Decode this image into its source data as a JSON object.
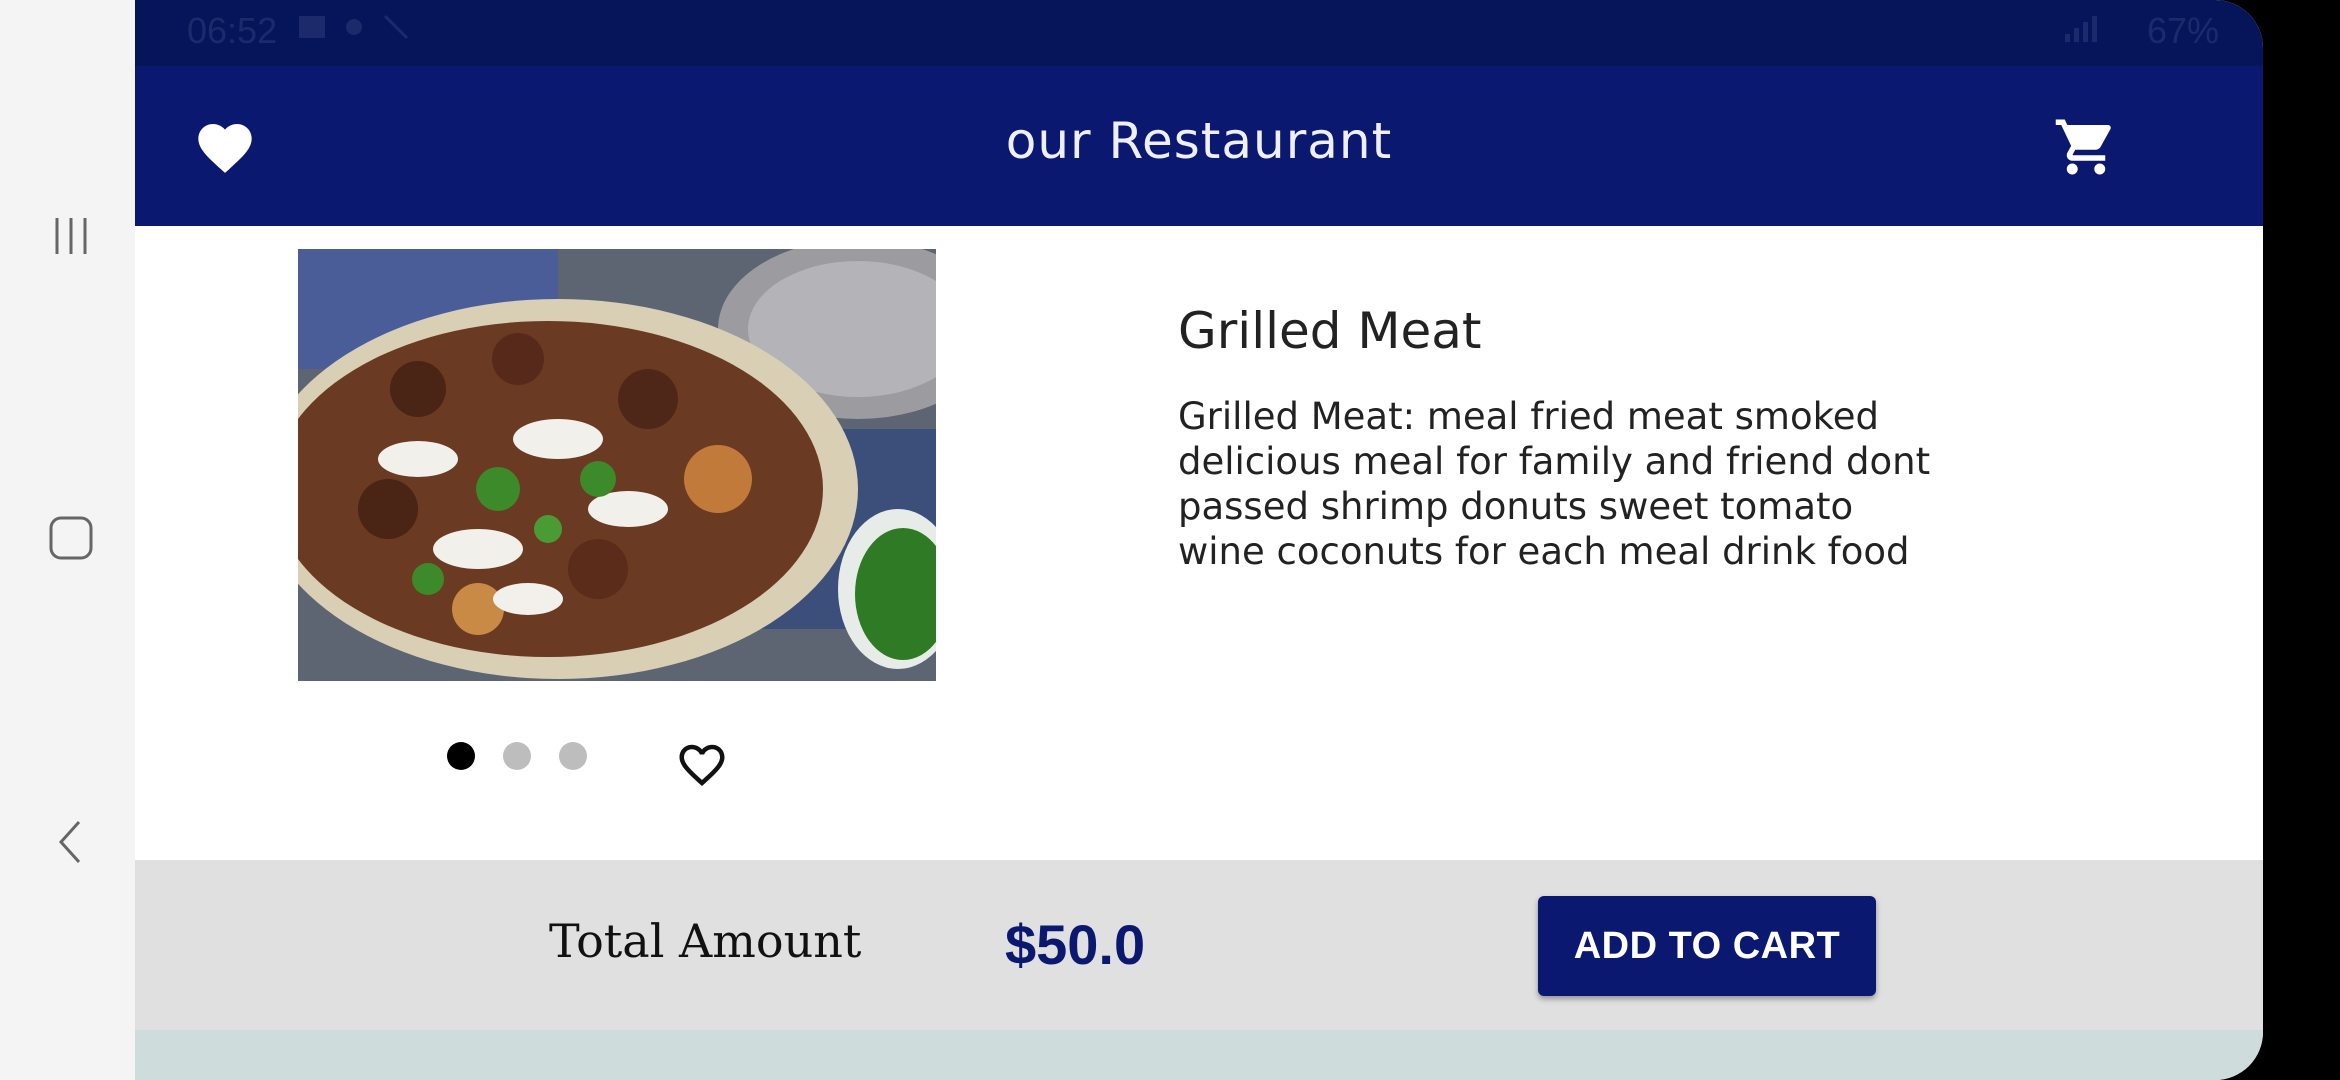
{
  "status_bar": {
    "time": "06:52",
    "battery": "67%",
    "icons": [
      "image-icon",
      "brightness-icon",
      "magic-wand-icon",
      "signal-icon",
      "battery-icon"
    ]
  },
  "app_bar": {
    "title": "our Restaurant",
    "favorites_icon": "heart-filled-icon",
    "cart_icon": "cart-icon"
  },
  "product": {
    "name": "Grilled Meat",
    "description": "Grilled Meat: meal fried meat smoked delicious meal for family and friend dont passed shrimp donuts sweet tomato wine coconuts for each meal drink food",
    "image_pager": {
      "page_count": 3,
      "current_page": 1
    },
    "like_icon": "heart-outline-icon"
  },
  "footer": {
    "total_label": "Total Amount",
    "total_value": "$50.0",
    "add_to_cart_label": "ADD TO CART"
  },
  "system_nav": {
    "icons": [
      "recents-icon",
      "home-icon",
      "back-icon"
    ]
  },
  "colors": {
    "primary": "#0b1870",
    "status_bar": "#061559",
    "footer_bg": "#e0e0e0",
    "accent_text": "#0b1870"
  }
}
